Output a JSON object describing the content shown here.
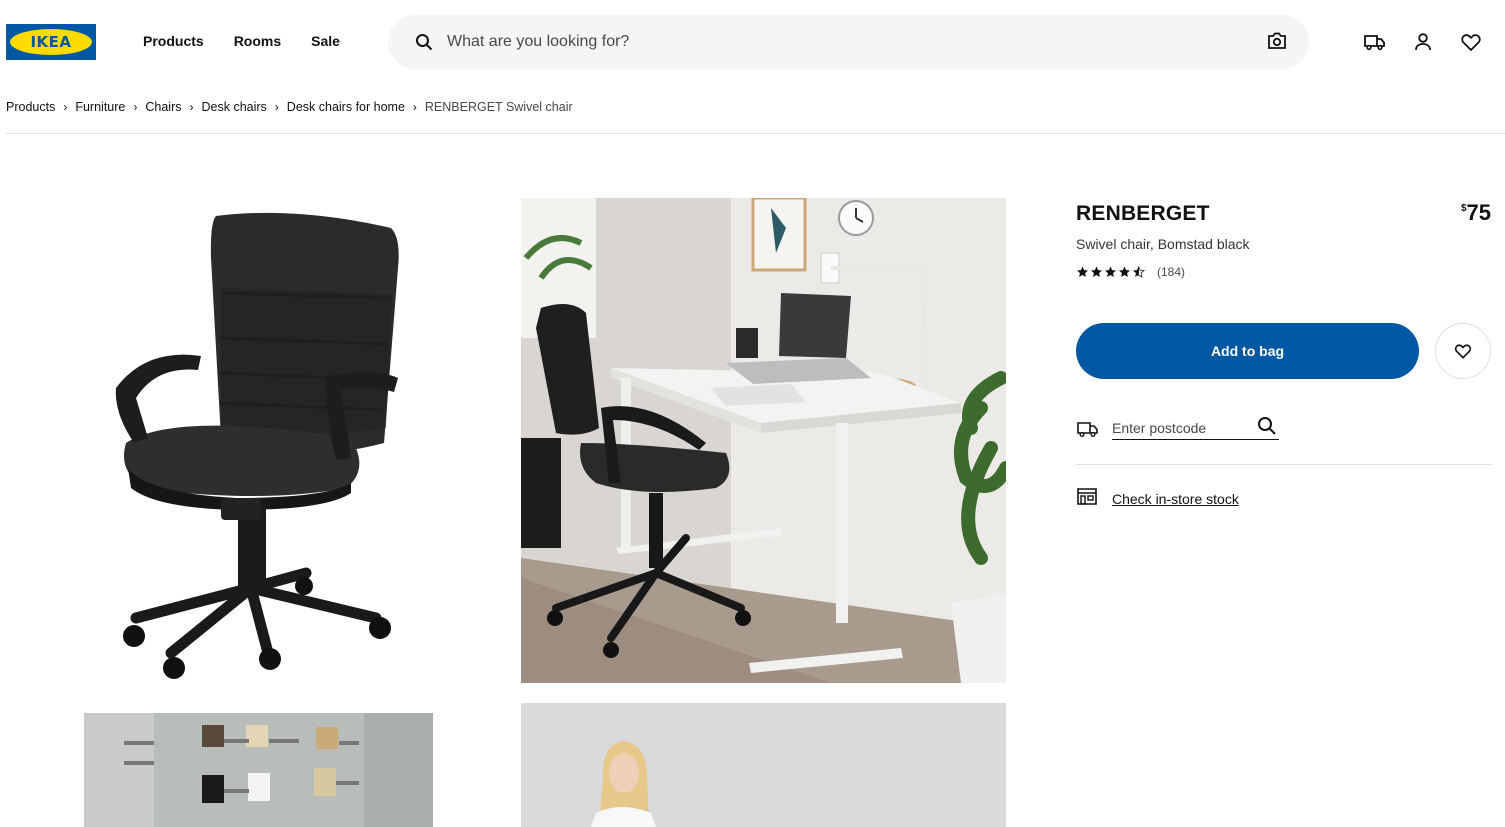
{
  "brand": {
    "logo_text": "IKEA",
    "blue": "#0058a3",
    "yellow": "#ffdb00"
  },
  "nav": [
    "Products",
    "Rooms",
    "Sale"
  ],
  "search": {
    "placeholder": "What are you looking for?",
    "value": ""
  },
  "header_icons": [
    "search-icon",
    "camera-icon",
    "truck-icon",
    "user-icon",
    "heart-icon"
  ],
  "breadcrumb": [
    "Products",
    "Furniture",
    "Chairs",
    "Desk chairs",
    "Desk chairs for home",
    "RENBERGET Swivel chair"
  ],
  "product": {
    "name": "RENBERGET",
    "description": "Swivel chair, Bomstad black",
    "price_currency": "$",
    "price_value": "75",
    "rating_stars": 4.5,
    "review_count": "(184)",
    "add_to_bag": "Add to bag"
  },
  "delivery": {
    "postcode_placeholder": "Enter postcode",
    "stock_link": "Check in-store stock"
  }
}
